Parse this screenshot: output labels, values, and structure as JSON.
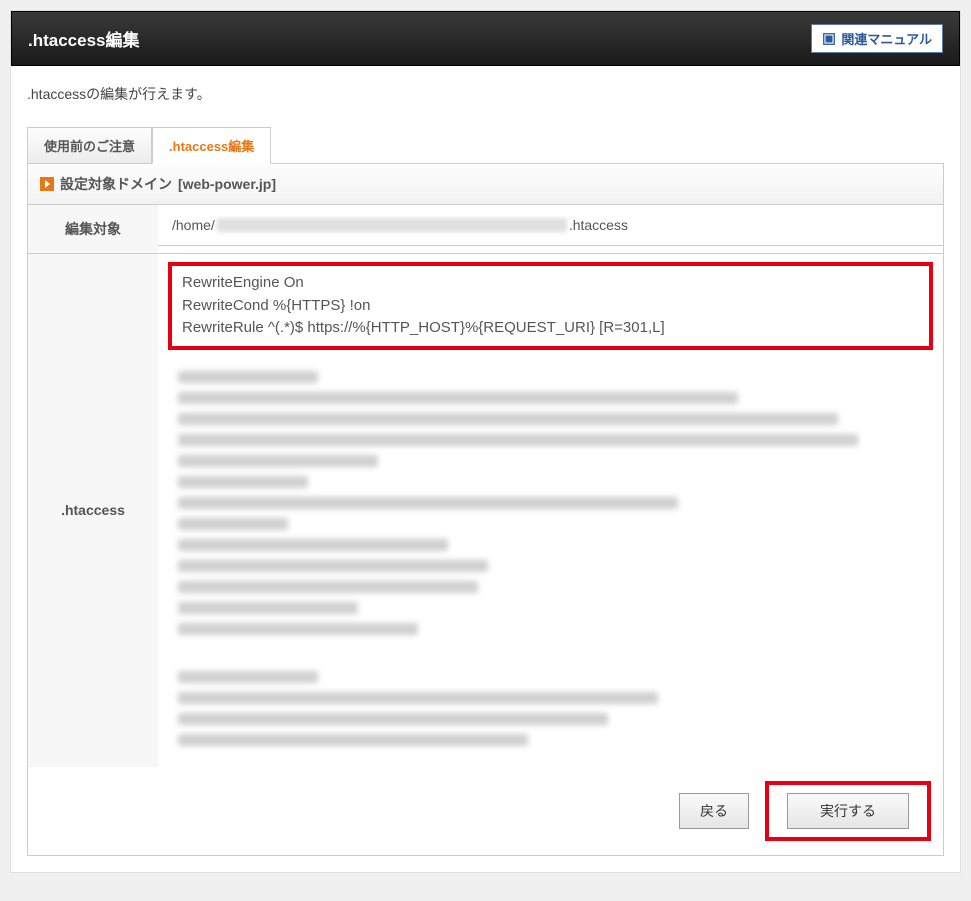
{
  "header": {
    "title": ".htaccess編集",
    "manual_button": "関連マニュアル"
  },
  "description": ".htaccessの編集が行えます。",
  "tabs": {
    "notice": "使用前のご注意",
    "edit": ".htaccess編集"
  },
  "section": {
    "title_prefix": "設定対象ドメイン",
    "domain": "[web-power.jp]"
  },
  "form": {
    "target_label": "編集対象",
    "path_prefix": "/home/",
    "path_suffix": ".htaccess",
    "htaccess_label": ".htaccess",
    "editor_line1": "RewriteEngine On",
    "editor_line2": "RewriteCond %{HTTPS} !on",
    "editor_line3": "RewriteRule ^(.*)$ https://%{HTTP_HOST}%{REQUEST_URI} [R=301,L]"
  },
  "buttons": {
    "back": "戻る",
    "execute": "実行する"
  }
}
